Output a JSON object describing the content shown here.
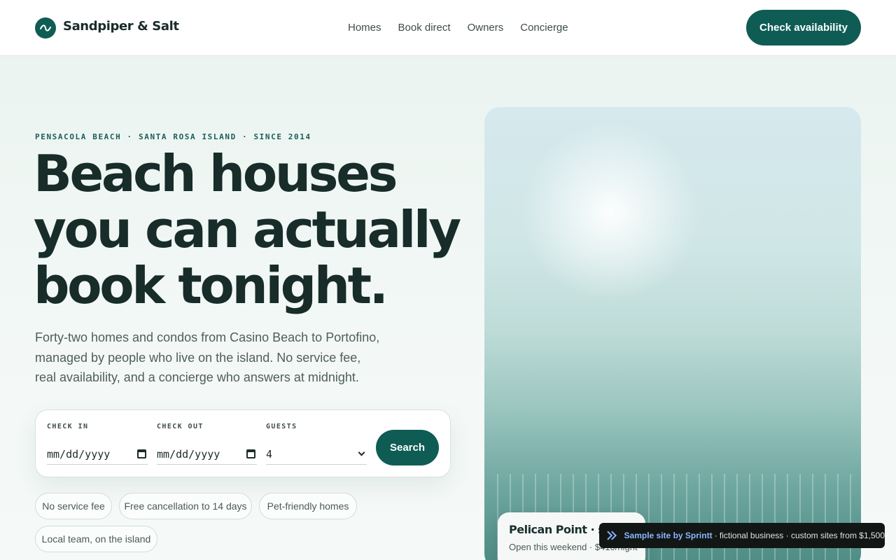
{
  "header": {
    "brand": "Sandpiper & Salt",
    "nav": [
      "Homes",
      "Book direct",
      "Owners",
      "Concierge"
    ],
    "cta_label": "Check availability"
  },
  "hero": {
    "eyebrow": "PENSACOLA BEACH · SANTA ROSA ISLAND · SINCE 2014",
    "headline_lines": [
      "Beach houses",
      "you can actually",
      "book tonight."
    ],
    "lede": "Forty-two homes and condos from Casino Beach to Portofino, managed by people who live on the island. No service fee, real availability, and a concierge who answers at midnight."
  },
  "search": {
    "check_in": {
      "label": "CHECK IN",
      "value": "mm/dd/yyyy"
    },
    "check_out": {
      "label": "CHECK OUT",
      "value": "mm/dd/yyyy"
    },
    "guests": {
      "label": "GUESTS",
      "value": "4"
    },
    "button_label": "Search"
  },
  "features": [
    "No service fee",
    "Free cancellation to 14 days",
    "Pet-friendly homes",
    "Local team, on the island"
  ],
  "listing_card": {
    "title": "Pelican Point · sl",
    "subtitle": "Open this weekend · $410/night"
  },
  "badge": {
    "strong": "Sample site by Sprintt",
    "rest": "· fictional business · custom sites from $1,500"
  },
  "colors": {
    "brand": "#0f5c55",
    "text_dark": "#182c29",
    "background": "#eef5f2"
  }
}
